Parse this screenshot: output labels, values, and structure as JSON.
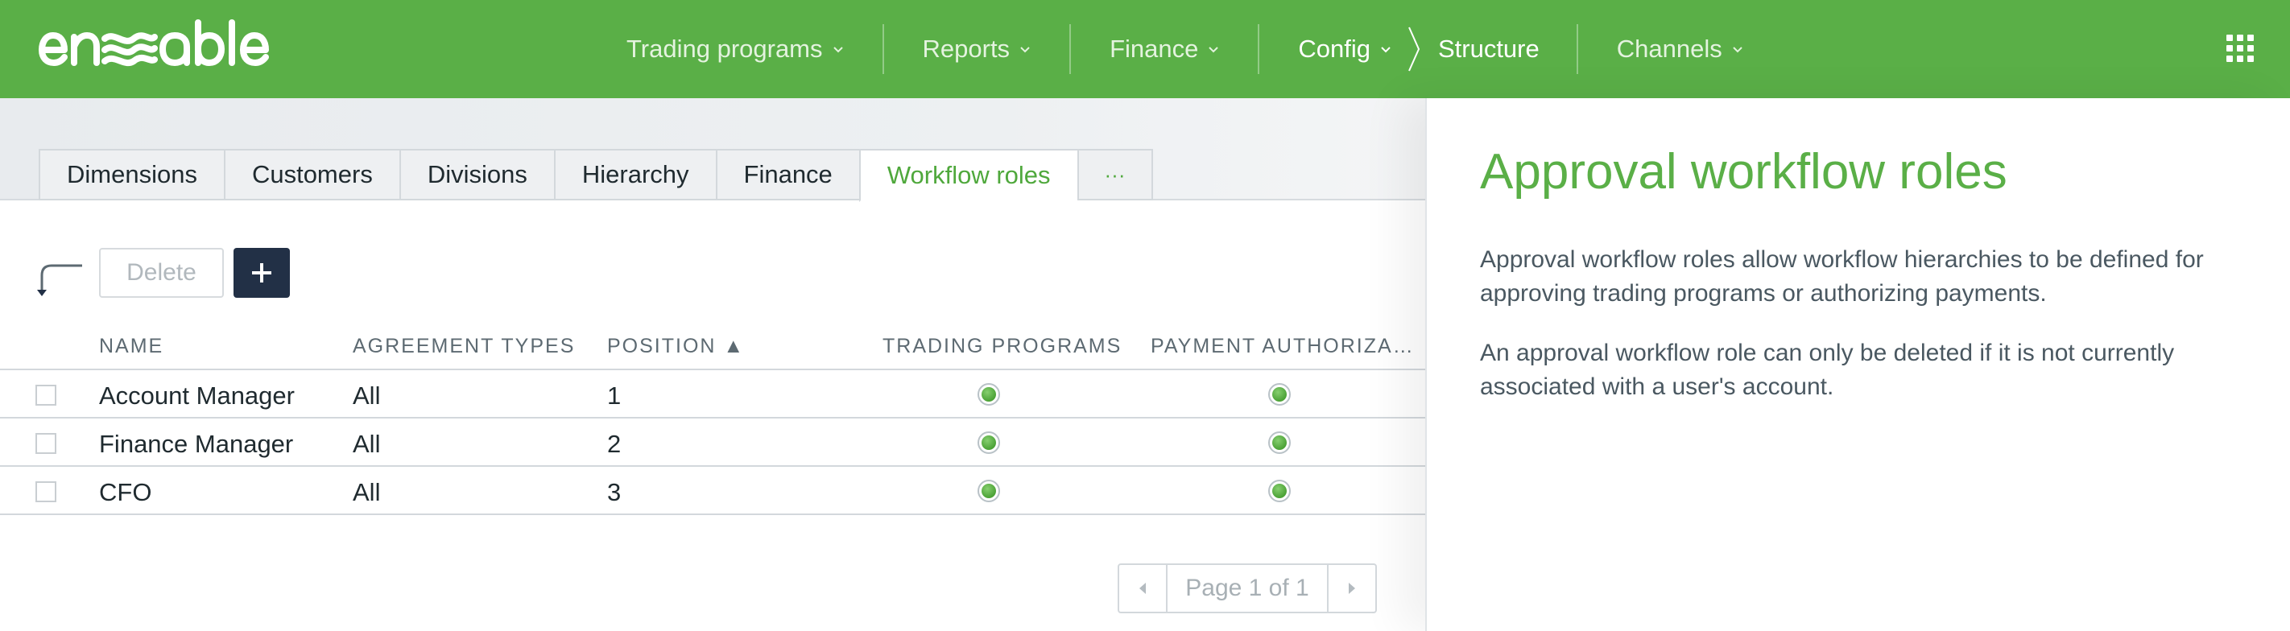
{
  "app": {
    "logo_text": "enable",
    "accent_color": "#5aaf47",
    "nav_bg": "#5aaf47"
  },
  "nav": {
    "items": [
      {
        "label": "Trading programs",
        "icon": "chevron-down-icon"
      },
      {
        "label": "Reports",
        "icon": "chevron-down-icon"
      },
      {
        "label": "Finance",
        "icon": "chevron-down-icon"
      },
      {
        "label": "Config",
        "icon": "chevron-down-icon"
      },
      {
        "label": "Channels",
        "icon": "chevron-down-icon"
      }
    ],
    "breadcrumb_current": "Structure",
    "apps_icon": "grid-icon"
  },
  "tabs": {
    "items": [
      "Dimensions",
      "Customers",
      "Divisions",
      "Hierarchy",
      "Finance",
      "Workflow roles"
    ],
    "active": "Workflow roles",
    "more_label": "···"
  },
  "toolbar": {
    "back_icon": "return-arrow-icon",
    "delete_label": "Delete",
    "add_icon": "plus-icon"
  },
  "table": {
    "columns": [
      "NAME",
      "AGREEMENT TYPES",
      "POSITION ▲",
      "TRADING PROGRAMS",
      "PAYMENT AUTHORIZA…"
    ],
    "rows": [
      {
        "name": "Account Manager",
        "agreement_types": "All",
        "position": "1",
        "trading_programs": true,
        "payment_authorization": true
      },
      {
        "name": "Finance Manager",
        "agreement_types": "All",
        "position": "2",
        "trading_programs": true,
        "payment_authorization": true
      },
      {
        "name": "CFO",
        "agreement_types": "All",
        "position": "3",
        "trading_programs": true,
        "payment_authorization": true
      }
    ]
  },
  "pager": {
    "label": "Page 1 of 1",
    "prev_icon": "caret-left-icon",
    "next_icon": "caret-right-icon"
  },
  "help": {
    "title": "Approval workflow roles",
    "p1": "Approval workflow roles allow workflow hierarchies to be defined for approving trading programs or authorizing payments.",
    "p2": "An approval workflow role can only be deleted if it is not currently associated with a user's account."
  }
}
